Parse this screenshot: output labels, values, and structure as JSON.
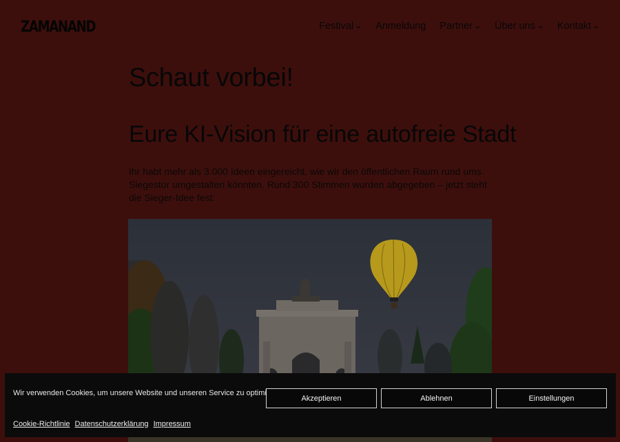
{
  "header": {
    "logo": "ZAMANAND",
    "nav": [
      {
        "label": "Festival",
        "has_dropdown": true
      },
      {
        "label": "Anmeldung",
        "has_dropdown": false
      },
      {
        "label": "Partner",
        "has_dropdown": true
      },
      {
        "label": "Über uns",
        "has_dropdown": true
      },
      {
        "label": "Kontakt",
        "has_dropdown": true
      }
    ]
  },
  "main": {
    "heading": "Schaut vorbei!",
    "subheading": "Eure KI-Vision für eine autofreie Stadt",
    "intro": "Ihr habt mehr als 3.000 Ideen eingereicht, wie wir den öffentlichen Raum rund ums Siegestor umgestalten könnten. Rund 300 Stimmen wurden abgegeben – jetzt steht die Sieger-Idee fest:"
  },
  "cookie_banner": {
    "message": "Wir verwenden Cookies, um unsere Website und unseren Service zu optimieren.",
    "accept_label": "Akzeptieren",
    "reject_label": "Ablehnen",
    "settings_label": "Einstellungen",
    "links": {
      "cookie_policy": "Cookie-Richtlinie",
      "privacy": "Datenschutzerklärung",
      "imprint": "Impressum"
    }
  },
  "colors": {
    "overlay_background": "#3d0f0c",
    "banner_background": "#0b0b0b",
    "balloon": "#b79a1c"
  }
}
